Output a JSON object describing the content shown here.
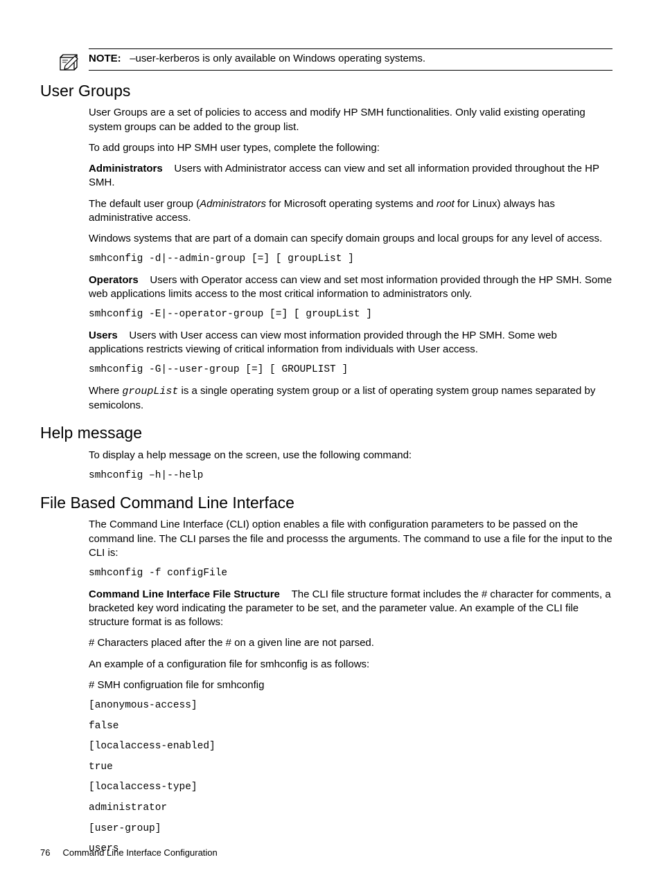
{
  "note": {
    "label": "NOTE:",
    "text": "–user-kerberos is only available on Windows operating systems."
  },
  "s1": {
    "title": "User Groups",
    "p1": "User Groups are a set of policies to access and modify HP SMH functionalities. Only valid existing operating system groups can be added to the group list.",
    "p2": "To add groups into HP SMH user types, complete the following:",
    "admin_label": "Administrators",
    "admin_text": "Users with Administrator access can view and set all information provided throughout the HP SMH.",
    "default_pre": "The default user group (",
    "default_em1": "Administrators",
    "default_mid": " for Microsoft operating systems and ",
    "default_em2": "root",
    "default_post": " for Linux) always has administrative access.",
    "windows": "Windows systems that are part of a domain can specify domain groups and local groups for any level of access.",
    "cmd_admin": "smhconfig -d|--admin-group [=] [ groupList ]",
    "op_label": "Operators",
    "op_text": "Users with Operator access can view and set most information provided through the HP SMH. Some web applications limits access to the most critical information to administrators only.",
    "cmd_op": "smhconfig -E|--operator-group [=] [ groupList ]",
    "user_label": "Users",
    "user_text": "Users with User access can view most information provided through the HP SMH. Some web applications restricts viewing of critical information from individuals with User access.",
    "cmd_user": "smhconfig -G|--user-group [=] [ GROUPLIST ]",
    "where_pre": "Where ",
    "where_code": "groupList",
    "where_post": " is a single operating system group or a list of operating system group names separated by semicolons."
  },
  "s2": {
    "title": "Help message",
    "p1": "To display a help message on the screen, use the following command:",
    "cmd": "smhconfig –h|--help"
  },
  "s3": {
    "title": "File Based Command Line Interface",
    "p1": "The Command Line Interface (CLI) option enables a file with configuration parameters to be passed on the command line. The CLI parses the file and processs the arguments. The command to use a file for the input to the CLI is:",
    "cmd1": "smhconfig -f configFile",
    "struct_label": "Command Line Interface File Structure",
    "struct_text": "The CLI file structure format includes the # character for comments, a bracketed key word indicating the parameter to be set, and the parameter value. An example of the CLI file structure format is as follows:",
    "hash": "# Characters placed after the # on a given line are not parsed.",
    "ex_intro": "An example of a configuration file for smhconfig is as follows:",
    "ex_header": "# SMH configruation file for smhconfig",
    "cfg1": "[anonymous-access]",
    "cfg2": "false",
    "cfg3": "[localaccess-enabled]",
    "cfg4": "true",
    "cfg5": "[localaccess-type]",
    "cfg6": "administrator",
    "cfg7": "[user-group]",
    "cfg8": "users"
  },
  "footer": {
    "page": "76",
    "title": "Command Line Interface Configuration"
  }
}
